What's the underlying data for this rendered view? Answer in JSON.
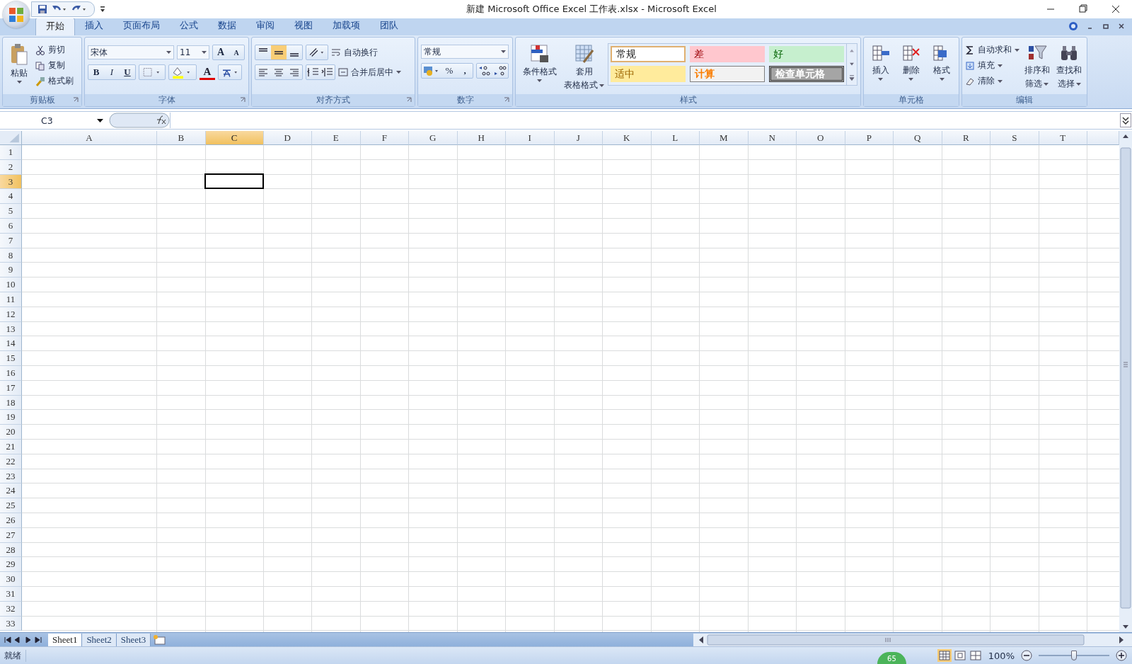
{
  "window": {
    "title": "新建 Microsoft Office Excel 工作表.xlsx - Microsoft Excel"
  },
  "tabs": [
    {
      "label": "开始",
      "selected": true
    },
    {
      "label": "插入",
      "selected": false
    },
    {
      "label": "页面布局",
      "selected": false
    },
    {
      "label": "公式",
      "selected": false
    },
    {
      "label": "数据",
      "selected": false
    },
    {
      "label": "审阅",
      "selected": false
    },
    {
      "label": "视图",
      "selected": false
    },
    {
      "label": "加载项",
      "selected": false
    },
    {
      "label": "团队",
      "selected": false
    }
  ],
  "clipboard": {
    "label": "剪贴板",
    "paste": "粘贴",
    "items": [
      "剪切",
      "复制",
      "格式刷"
    ]
  },
  "font": {
    "label": "字体",
    "font_name": "宋体",
    "font_size": "11",
    "grow": "A",
    "shrink": "A",
    "bold": "B",
    "italic": "I",
    "underline": "U",
    "font_color": "A"
  },
  "alignment": {
    "label": "对齐方式",
    "wrap": "自动换行",
    "merge": "合并后居中",
    "middle_align_selected": true
  },
  "number": {
    "label": "数字",
    "format": "常规",
    "percent": "%",
    "comma": ","
  },
  "styles": {
    "label": "样式",
    "conditional": "条件格式",
    "table_format": [
      "套用",
      "表格格式"
    ],
    "cells": [
      {
        "label": "常规",
        "color": "#ffffff"
      },
      {
        "label": "差",
        "color": "#ffc7ce"
      },
      {
        "label": "好",
        "color": "#c6efce"
      },
      {
        "label": "适中",
        "color": "#ffeb9c"
      },
      {
        "label": "计算",
        "color": "#f2f2f2"
      },
      {
        "label": "检查单元格",
        "color": "#a5a5a5"
      }
    ]
  },
  "cells_group": {
    "label": "单元格",
    "buttons": [
      "插入",
      "删除",
      "格式"
    ]
  },
  "editing": {
    "label": "编辑",
    "items": [
      "自动求和",
      "填充",
      "清除"
    ],
    "sort": [
      "排序和",
      "筛选"
    ],
    "find": [
      "查找和",
      "选择"
    ]
  },
  "name_box": "C3",
  "columns": [
    {
      "label": "A",
      "selected": false
    },
    {
      "label": "B",
      "selected": false
    },
    {
      "label": "C",
      "selected": true
    },
    {
      "label": "D",
      "selected": false
    },
    {
      "label": "E",
      "selected": false
    },
    {
      "label": "F",
      "selected": false
    },
    {
      "label": "G",
      "selected": false
    },
    {
      "label": "H",
      "selected": false
    },
    {
      "label": "I",
      "selected": false
    },
    {
      "label": "J",
      "selected": false
    },
    {
      "label": "K",
      "selected": false
    },
    {
      "label": "L",
      "selected": false
    },
    {
      "label": "M",
      "selected": false
    },
    {
      "label": "N",
      "selected": false
    },
    {
      "label": "O",
      "selected": false
    },
    {
      "label": "P",
      "selected": false
    },
    {
      "label": "Q",
      "selected": false
    },
    {
      "label": "R",
      "selected": false
    },
    {
      "label": "S",
      "selected": false
    },
    {
      "label": "T",
      "selected": false
    }
  ],
  "rows": [
    {
      "label": "1",
      "selected": false
    },
    {
      "label": "2",
      "selected": false
    },
    {
      "label": "3",
      "selected": true
    },
    {
      "label": "4",
      "selected": false
    },
    {
      "label": "5",
      "selected": false
    },
    {
      "label": "6",
      "selected": false
    },
    {
      "label": "7",
      "selected": false
    },
    {
      "label": "8",
      "selected": false
    },
    {
      "label": "9",
      "selected": false
    },
    {
      "label": "10",
      "selected": false
    },
    {
      "label": "11",
      "selected": false
    },
    {
      "label": "12",
      "selected": false
    },
    {
      "label": "13",
      "selected": false
    },
    {
      "label": "14",
      "selected": false
    },
    {
      "label": "15",
      "selected": false
    },
    {
      "label": "16",
      "selected": false
    },
    {
      "label": "17",
      "selected": false
    },
    {
      "label": "18",
      "selected": false
    },
    {
      "label": "19",
      "selected": false
    },
    {
      "label": "20",
      "selected": false
    },
    {
      "label": "21",
      "selected": false
    },
    {
      "label": "22",
      "selected": false
    },
    {
      "label": "23",
      "selected": false
    },
    {
      "label": "24",
      "selected": false
    },
    {
      "label": "25",
      "selected": false
    },
    {
      "label": "26",
      "selected": false
    },
    {
      "label": "27",
      "selected": false
    },
    {
      "label": "28",
      "selected": false
    },
    {
      "label": "29",
      "selected": false
    },
    {
      "label": "30",
      "selected": false
    },
    {
      "label": "31",
      "selected": false
    },
    {
      "label": "32",
      "selected": false
    },
    {
      "label": "33",
      "selected": false
    }
  ],
  "sheets": [
    {
      "label": "Sheet1",
      "selected": true
    },
    {
      "label": "Sheet2",
      "selected": false
    },
    {
      "label": "Sheet3",
      "selected": false
    }
  ],
  "status_bar": {
    "text": "就绪",
    "badge": "65",
    "zoom": "100%",
    "zoom_slider": {
      "level": 0.5
    }
  }
}
